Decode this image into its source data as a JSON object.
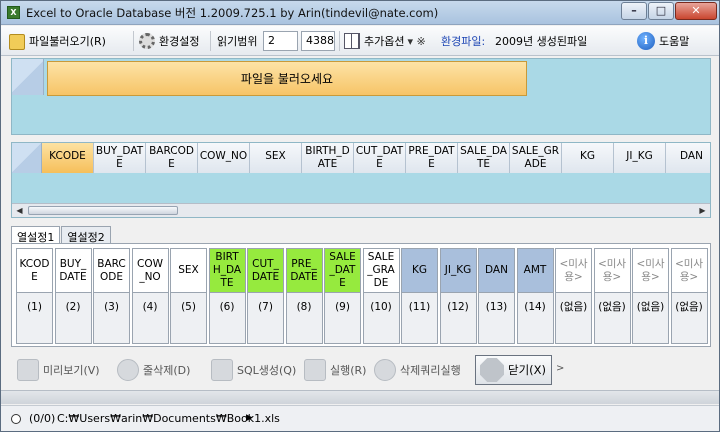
{
  "window": {
    "title": "Excel to Oracle Database 버전 1.2009.725.1 by Arin(tindevil@nate.com)",
    "controls": {
      "minimize": "–",
      "maximize": "□",
      "close": "✕"
    }
  },
  "toolbar": {
    "file_load": "파일불러오기(R)",
    "env_settings": "환경설정",
    "read_range_label": "읽기범위",
    "read_range_from": "2",
    "read_range_to": "4388",
    "add_options": "추가옵션",
    "options_mark": "▾ ※",
    "env_file_label": "환경파일:",
    "env_file_value": "2009년 생성된파일",
    "help": "도움말",
    "help_icon": "i"
  },
  "top_panel": {
    "load_prompt": "파일을 불러오세요"
  },
  "grid": {
    "columns": [
      "KCODE",
      "BUY_DATE",
      "BARCODE",
      "COW_NO",
      "SEX",
      "BIRTH_DATE",
      "CUT_DATE",
      "PRE_DATE",
      "SALE_DATE",
      "SALE_GRADE",
      "KG",
      "JI_KG",
      "DAN"
    ],
    "scroll_left": "◀",
    "scroll_right": "▶"
  },
  "tabs": {
    "tab1": "열설정1",
    "tab2": "열설정2"
  },
  "column_settings": [
    {
      "name": "KCODE",
      "num": "(1)",
      "style": "n"
    },
    {
      "name": "BUY_DATE",
      "num": "(2)",
      "style": "n"
    },
    {
      "name": "BARCODE",
      "num": "(3)",
      "style": "n"
    },
    {
      "name": "COW_NO",
      "num": "(4)",
      "style": "n"
    },
    {
      "name": "SEX",
      "num": "(5)",
      "style": "n"
    },
    {
      "name": "BIRTH_DATE",
      "num": "(6)",
      "style": "g"
    },
    {
      "name": "CUT_DATE",
      "num": "(7)",
      "style": "g"
    },
    {
      "name": "PRE_DATE",
      "num": "(8)",
      "style": "g"
    },
    {
      "name": "SALE_DATE",
      "num": "(9)",
      "style": "g"
    },
    {
      "name": "SALE_GRADE",
      "num": "(10)",
      "style": "n"
    },
    {
      "name": "KG",
      "num": "(11)",
      "style": "b"
    },
    {
      "name": "JI_KG",
      "num": "(12)",
      "style": "b"
    },
    {
      "name": "DAN",
      "num": "(13)",
      "style": "b"
    },
    {
      "name": "AMT",
      "num": "(14)",
      "style": "b"
    },
    {
      "name": "<미사용>",
      "num": "(없음)",
      "style": "u"
    },
    {
      "name": "<미사용>",
      "num": "(없음)",
      "style": "u"
    },
    {
      "name": "<미사용>",
      "num": "(없음)",
      "style": "u"
    },
    {
      "name": "<미사용>",
      "num": "(없음)",
      "style": "u"
    }
  ],
  "actions": {
    "preview": "미리보기(V)",
    "delete_rows": "줄삭제(D)",
    "sql_gen": "SQL생성(Q)",
    "run": "실행(R)",
    "delete_query_run": "삭제쿼리실행",
    "close": "닫기(X)",
    "more": ">"
  },
  "status": {
    "count": "(0/0)",
    "path": "C:₩Users₩arin₩Documents₩Book1.xls",
    "arrow": "▶"
  }
}
